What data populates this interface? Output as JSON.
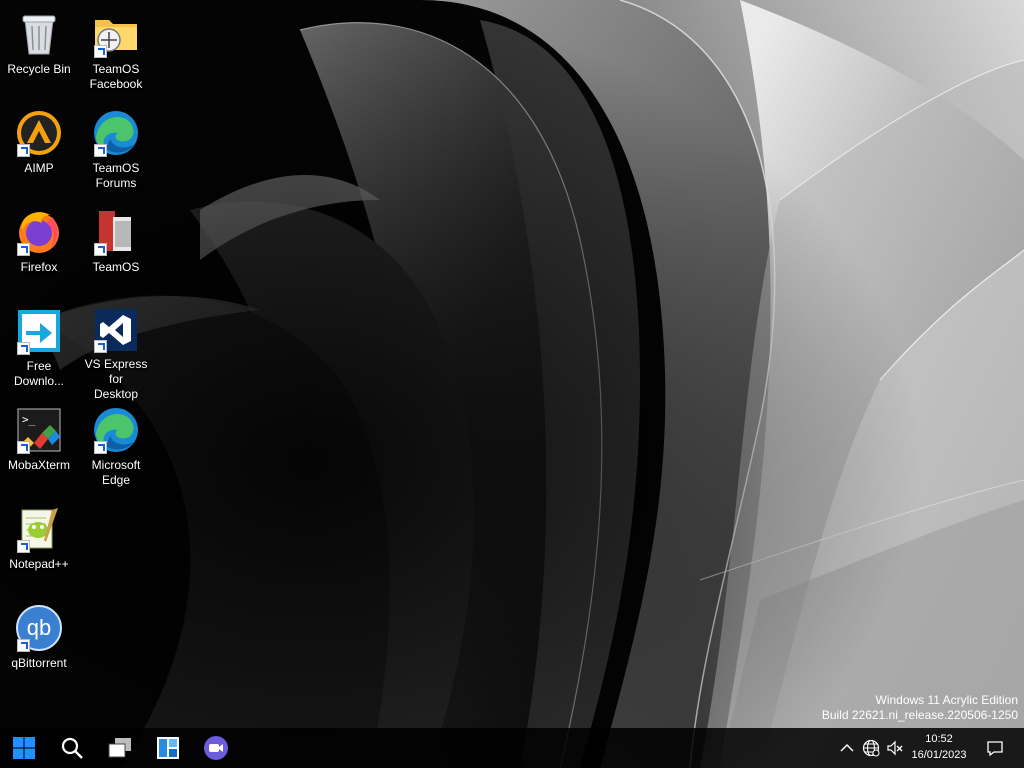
{
  "desktop": {
    "icons": [
      {
        "label": "Recycle Bin",
        "icon": "recycle-bin-icon"
      },
      {
        "label": "TeamOS\nFacebook",
        "icon": "folder-link-icon"
      },
      {
        "label": "AIMP",
        "icon": "aimp-icon"
      },
      {
        "label": "TeamOS\nForums",
        "icon": "edge-icon"
      },
      {
        "label": "Firefox",
        "icon": "firefox-icon"
      },
      {
        "label": "TeamOS",
        "icon": "teamos-icon"
      },
      {
        "label": "Free\nDownlo...",
        "icon": "download-manager-icon"
      },
      {
        "label": "VS Express for\nDesktop",
        "icon": "visual-studio-icon"
      },
      {
        "label": "MobaXterm",
        "icon": "mobaxterm-icon"
      },
      {
        "label": "Microsoft\nEdge",
        "icon": "edge-icon"
      },
      {
        "label": "Notepad++",
        "icon": "notepadpp-icon"
      },
      {
        "label": "qBittorrent",
        "icon": "qbittorrent-icon"
      }
    ]
  },
  "watermark": {
    "line1": "Windows 11 Acrylic Edition",
    "line2": "Build 22621.ni_release.220506-1250"
  },
  "taskbar": {
    "buttons": [
      "start-icon",
      "search-icon",
      "task-view-icon",
      "widgets-icon",
      "chat-icon"
    ],
    "tray": [
      "chevron-up-icon",
      "network-icon",
      "volume-muted-icon",
      "notification-icon"
    ],
    "time": "10:52",
    "date": "16/01/2023"
  },
  "colors": {
    "start_blue": "#1e90ff",
    "edge_blue": "#1a8ad4",
    "edge_green": "#4cc46b",
    "aimp_orange": "#f5a10f",
    "chat_purple": "#6b5ddc"
  }
}
